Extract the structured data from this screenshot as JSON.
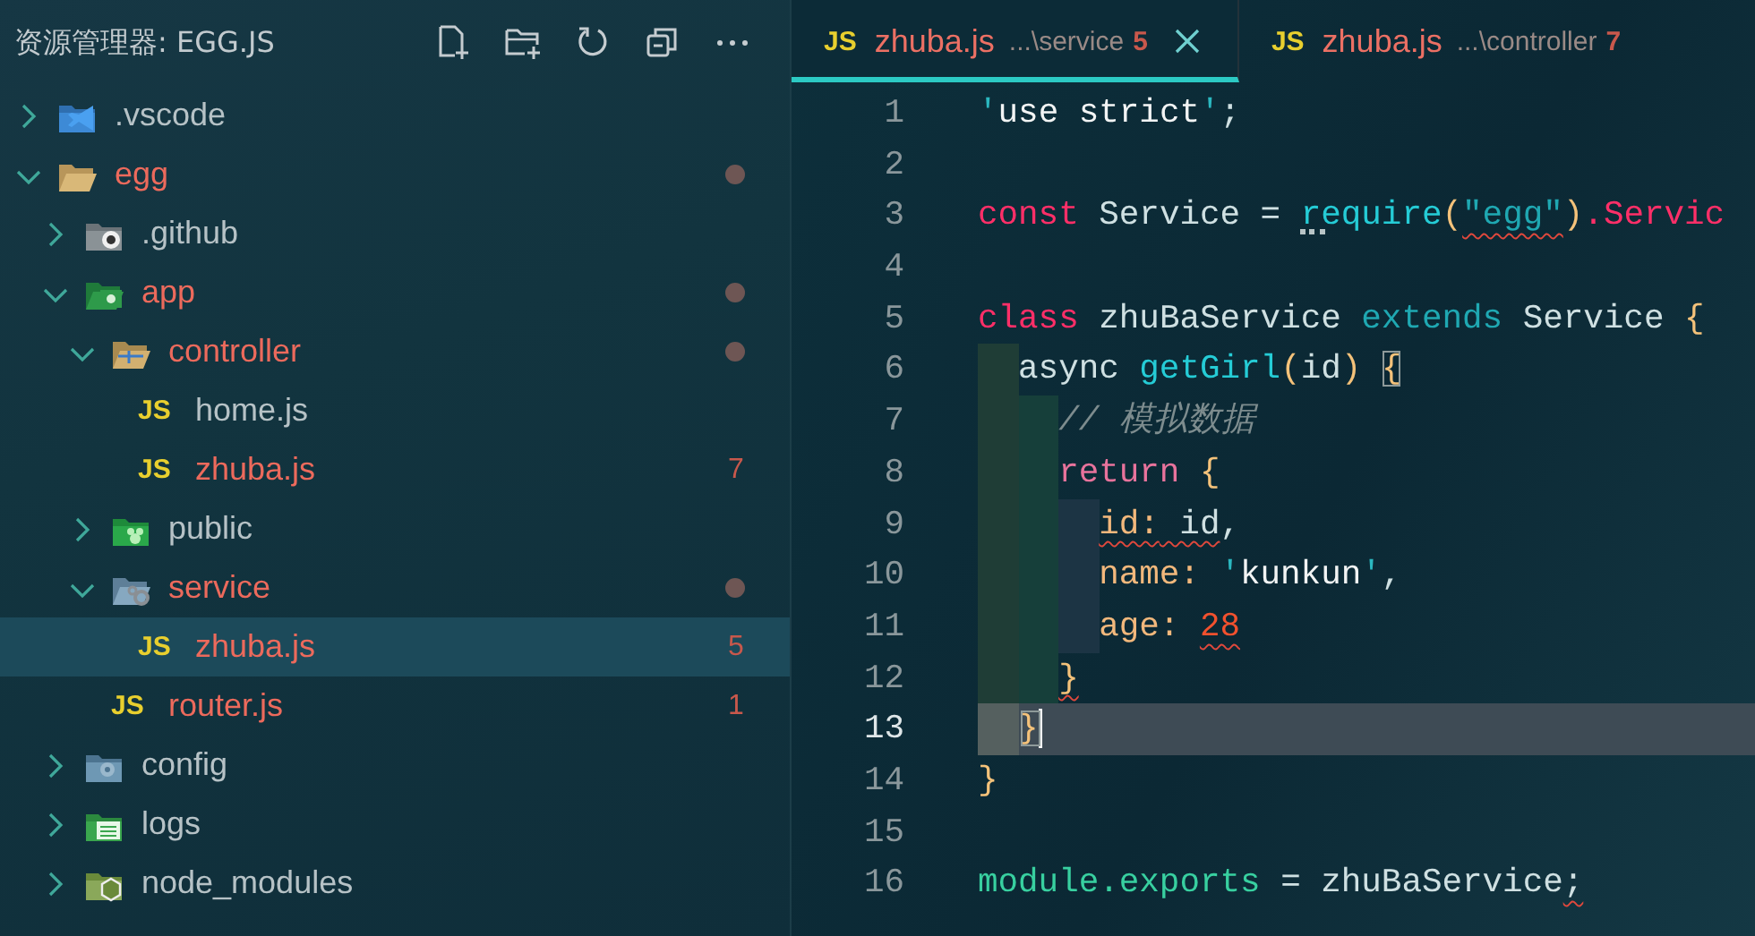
{
  "sidebar": {
    "title": "资源管理器: EGG.JS",
    "tree": [
      {
        "name": ".vscode",
        "kind": "vscode",
        "expanded": false,
        "problem": false,
        "modified": false
      },
      {
        "name": "egg",
        "kind": "plain",
        "expanded": true,
        "problem": true,
        "modified": true,
        "children": [
          {
            "name": ".github",
            "kind": "github",
            "expanded": false,
            "problem": false,
            "modified": false
          },
          {
            "name": "app",
            "kind": "app",
            "expanded": true,
            "problem": true,
            "modified": true,
            "children": [
              {
                "name": "controller",
                "kind": "controller",
                "expanded": true,
                "problem": true,
                "modified": true,
                "children": [
                  {
                    "name": "home.js",
                    "kind": "js",
                    "icon": "JS",
                    "problem": false,
                    "modified": false,
                    "selected": false
                  },
                  {
                    "name": "zhuba.js",
                    "kind": "js",
                    "icon": "JS",
                    "problem": true,
                    "modified": false,
                    "badge": "7",
                    "selected": false
                  }
                ]
              },
              {
                "name": "public",
                "kind": "public",
                "expanded": false,
                "problem": false,
                "modified": false
              },
              {
                "name": "service",
                "kind": "service",
                "expanded": true,
                "problem": true,
                "modified": true,
                "children": [
                  {
                    "name": "zhuba.js",
                    "kind": "js",
                    "icon": "JS",
                    "problem": true,
                    "modified": false,
                    "badge": "5",
                    "selected": true
                  }
                ]
              },
              {
                "name": "router.js",
                "kind": "js",
                "icon": "JS",
                "problem": true,
                "modified": false,
                "badge": "1",
                "selected": false
              }
            ]
          },
          {
            "name": "config",
            "kind": "config",
            "expanded": false,
            "problem": false,
            "modified": false
          },
          {
            "name": "logs",
            "kind": "logs",
            "expanded": false,
            "problem": false,
            "modified": false
          },
          {
            "name": "node_modules",
            "kind": "node",
            "expanded": false,
            "problem": false,
            "modified": false
          }
        ]
      }
    ]
  },
  "tabs": [
    {
      "icon": "JS",
      "name": "zhuba.js",
      "description": "...\\service",
      "count": "5",
      "selected": true
    },
    {
      "icon": "JS",
      "name": "zhuba.js",
      "description": "...\\controller",
      "count": "7",
      "selected": false
    }
  ],
  "editor": {
    "lines": [
      {
        "number": "1",
        "tokens": [
          {
            "text": "'",
            "kind": "quote"
          },
          {
            "text": "use strict",
            "kind": "string"
          },
          {
            "text": "'",
            "kind": "quote"
          },
          {
            "text": ";",
            "kind": "plain"
          }
        ]
      },
      {
        "number": "2"
      },
      {
        "number": "3",
        "tokens": [
          {
            "text": "const",
            "kind": "storage"
          },
          {
            "text": " Service = ",
            "kind": "plain"
          },
          {
            "text": "require",
            "kind": "func",
            "hint": true
          },
          {
            "text": "(",
            "kind": "punct"
          },
          {
            "text": "\"egg\"",
            "kind": "extends",
            "squiggle": true
          },
          {
            "text": ")",
            "kind": "punct"
          },
          {
            "text": ".Servic",
            "kind": "storage"
          }
        ]
      },
      {
        "number": "4"
      },
      {
        "number": "5",
        "tokens": [
          {
            "text": "class",
            "kind": "storage"
          },
          {
            "text": " zhuBaService ",
            "kind": "plain"
          },
          {
            "text": "extends",
            "kind": "extends"
          },
          {
            "text": " Service ",
            "kind": "plain"
          },
          {
            "text": "{",
            "kind": "punct"
          }
        ]
      },
      {
        "number": "6",
        "guides": [
          {
            "color": "#1f3d36"
          }
        ],
        "tokens": [
          {
            "text": "async ",
            "kind": "plain"
          },
          {
            "text": "getGirl",
            "kind": "func"
          },
          {
            "text": "(",
            "kind": "punct"
          },
          {
            "text": "id",
            "kind": "plain"
          },
          {
            "text": ") ",
            "kind": "punct"
          },
          {
            "text": "{",
            "kind": "punct",
            "match": true
          }
        ]
      },
      {
        "number": "7",
        "guides": [
          {
            "color": "#1f3d36"
          },
          {
            "color": "#163f3a"
          }
        ],
        "tokens": [
          {
            "text": "// 模拟数据",
            "kind": "comment"
          }
        ]
      },
      {
        "number": "8",
        "guides": [
          {
            "color": "#1f3d36"
          },
          {
            "color": "#163f3a"
          }
        ],
        "tokens": [
          {
            "text": "return",
            "kind": "control"
          },
          {
            "text": " {",
            "kind": "punct"
          }
        ]
      },
      {
        "number": "9",
        "guides": [
          {
            "color": "#1f3d36"
          },
          {
            "color": "#163f3a"
          },
          {
            "color": "#1c3444"
          }
        ],
        "tokens": [
          {
            "text": "id:",
            "kind": "property",
            "squiggle": true
          },
          {
            "text": " id",
            "kind": "plain",
            "squiggle": true
          },
          {
            "text": ",",
            "kind": "plain"
          }
        ]
      },
      {
        "number": "10",
        "guides": [
          {
            "color": "#1f3d36"
          },
          {
            "color": "#163f3a"
          },
          {
            "color": "#1c3444"
          }
        ],
        "tokens": [
          {
            "text": "name: ",
            "kind": "property"
          },
          {
            "text": "'",
            "kind": "quote"
          },
          {
            "text": "kunkun",
            "kind": "string"
          },
          {
            "text": "'",
            "kind": "quote"
          },
          {
            "text": ",",
            "kind": "plain"
          }
        ]
      },
      {
        "number": "11",
        "guides": [
          {
            "color": "#1f3d36"
          },
          {
            "color": "#163f3a"
          },
          {
            "color": "#1c3444"
          }
        ],
        "tokens": [
          {
            "text": "age: ",
            "kind": "property"
          },
          {
            "text": "28",
            "kind": "number",
            "squiggle": true
          }
        ]
      },
      {
        "number": "12",
        "guides": [
          {
            "color": "#1f3d36"
          },
          {
            "color": "#163f3a"
          }
        ],
        "tokens": [
          {
            "text": "}",
            "kind": "punct",
            "squiggle": true
          }
        ]
      },
      {
        "number": "13",
        "guides": [
          {
            "color": "#55605f"
          }
        ],
        "current": true,
        "tokens": [
          {
            "text": "}",
            "kind": "punct",
            "match": true
          }
        ]
      },
      {
        "number": "14",
        "tokens": [
          {
            "text": "}",
            "kind": "punct"
          }
        ]
      },
      {
        "number": "15"
      },
      {
        "number": "16",
        "tokens": [
          {
            "text": "module.exports",
            "kind": "module"
          },
          {
            "text": " = zhuBaService",
            "kind": "plain"
          },
          {
            "text": ";",
            "kind": "plain",
            "squiggle": true
          }
        ]
      }
    ]
  }
}
